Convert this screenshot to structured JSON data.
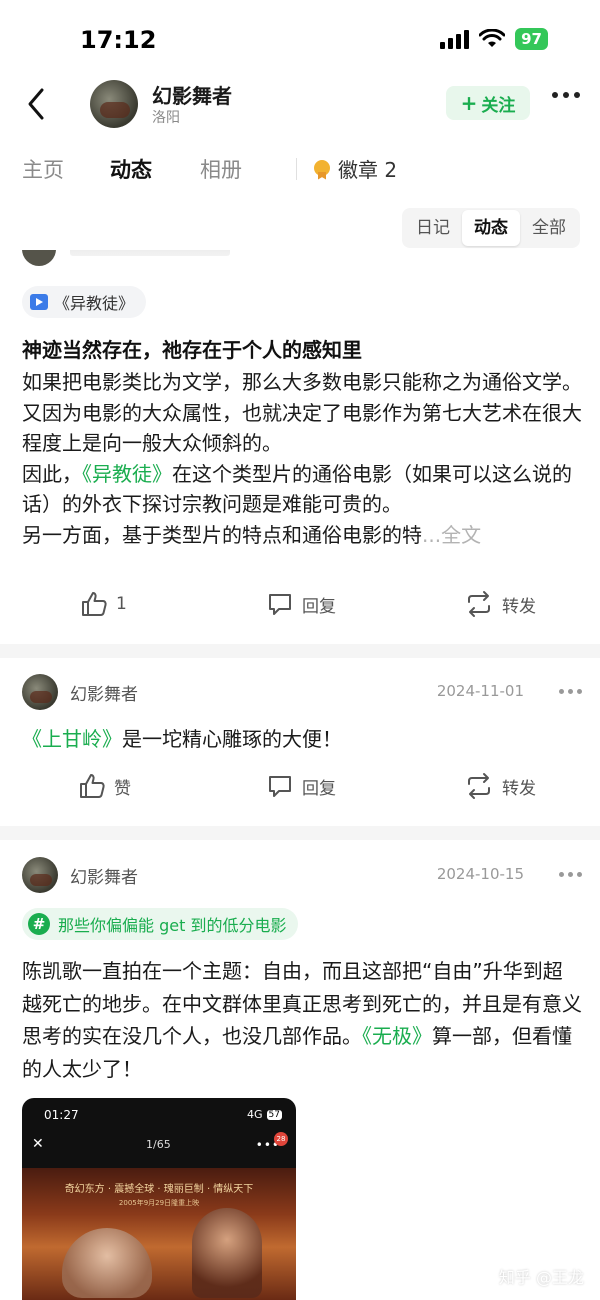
{
  "status_bar": {
    "time": "17:12",
    "battery": "97"
  },
  "header": {
    "user_name": "幻影舞者",
    "location": "洛阳",
    "follow_label": "关注"
  },
  "tabs": [
    {
      "label": "主页"
    },
    {
      "label": "动态"
    },
    {
      "label": "相册"
    }
  ],
  "badge_tab": {
    "label": "徽章 2"
  },
  "filter": {
    "options": [
      "日记",
      "动态",
      "全部"
    ],
    "selected": "动态"
  },
  "posts": [
    {
      "chip": "《异教徒》",
      "title": "神迹当然存在，祂存在于个人的感知里",
      "body_line1": "如果把电影类比为文学，那么大多数电影只能称之为通俗文学。又因为电影的大众属性，也就决定了电影作为第七大艺术在很大程度上是向一般大众倾斜的。",
      "body_prefix": "因此，",
      "body_link": "《异教徒》",
      "body_suffix": "在这个类型片的通俗电影（如果可以这么说的话）的外衣下探讨宗教问题是难能可贵的。",
      "body_line3": "另一方面，基于类型片的特点和通俗电影的特",
      "ellipsis": "...",
      "more_label": "全文",
      "like_count": "1",
      "comment_label": "回复",
      "repost_label": "转发"
    },
    {
      "author": "幻影舞者",
      "date": "2024-11-01",
      "link": "《上甘岭》",
      "text": "是一坨精心雕琢的大便！",
      "like_label": "赞",
      "comment_label": "回复",
      "repost_label": "转发"
    },
    {
      "author": "幻影舞者",
      "date": "2024-10-15",
      "topic": "那些你偏偏能 get 到的低分电影",
      "text": "陈凯歌一直拍在一个主题：自由，而且这部把“自由”升华到超越死亡的地步。在中文群体里真正思考到死亡的，并且是有意义思考的实在没几个人，也没几部作品。",
      "link": "《无极》",
      "text_suffix": "算一部，但看懂的人太少了！",
      "image": {
        "time": "01:27",
        "network": "4G",
        "battery": "57",
        "counter": "1/65",
        "badge": "28",
        "poster_tagline": "奇幻东方 · 震撼全球 · 瑰丽巨制 · 情纵天下",
        "poster_date": "2005年9月29日隆重上映"
      }
    }
  ],
  "watermark": "知乎 @王龙"
}
